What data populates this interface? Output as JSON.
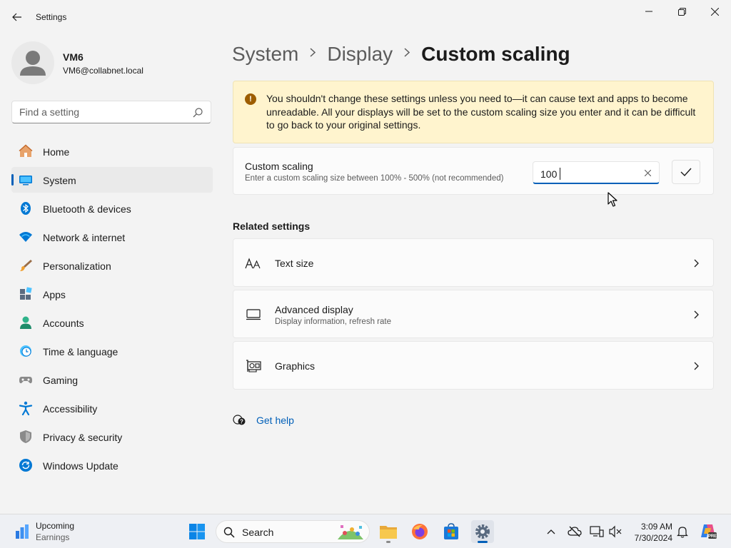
{
  "window": {
    "app_title": "Settings"
  },
  "profile": {
    "name": "VM6",
    "email": "VM6@collabnet.local"
  },
  "search": {
    "placeholder": "Find a setting"
  },
  "nav": {
    "items": [
      {
        "label": "Home",
        "icon": "home-icon"
      },
      {
        "label": "System",
        "icon": "system-icon"
      },
      {
        "label": "Bluetooth & devices",
        "icon": "bluetooth-icon"
      },
      {
        "label": "Network & internet",
        "icon": "wifi-icon"
      },
      {
        "label": "Personalization",
        "icon": "brush-icon"
      },
      {
        "label": "Apps",
        "icon": "apps-icon"
      },
      {
        "label": "Accounts",
        "icon": "account-icon"
      },
      {
        "label": "Time & language",
        "icon": "clock-globe-icon"
      },
      {
        "label": "Gaming",
        "icon": "gamepad-icon"
      },
      {
        "label": "Accessibility",
        "icon": "accessibility-icon"
      },
      {
        "label": "Privacy & security",
        "icon": "shield-icon"
      },
      {
        "label": "Windows Update",
        "icon": "update-icon"
      }
    ],
    "active": "System"
  },
  "breadcrumb": {
    "items": [
      "System",
      "Display",
      "Custom scaling"
    ]
  },
  "warning": {
    "text": "You shouldn't change these settings unless you need to—it can cause text and apps to become unreadable. All your displays will be set to the custom scaling size you enter and it can be difficult to go back to your original settings.",
    "icon": "warning-icon"
  },
  "custom_scaling": {
    "title": "Custom scaling",
    "description": "Enter a custom scaling size between 100% - 500% (not recommended)",
    "value": "100"
  },
  "related": {
    "heading": "Related settings",
    "items": [
      {
        "title": "Text size",
        "subtitle": "",
        "icon": "text-size-icon"
      },
      {
        "title": "Advanced display",
        "subtitle": "Display information, refresh rate",
        "icon": "monitor-icon"
      },
      {
        "title": "Graphics",
        "subtitle": "",
        "icon": "graphics-card-icon"
      }
    ]
  },
  "help": {
    "label": "Get help"
  },
  "taskbar": {
    "widget_title": "Upcoming",
    "widget_sub": "Earnings",
    "search_label": "Search",
    "time": "3:09 AM",
    "date": "7/30/2024"
  },
  "colors": {
    "accent": "#005fb8",
    "warning_bg": "#fff4ce",
    "warning_icon": "#9d5d00"
  }
}
